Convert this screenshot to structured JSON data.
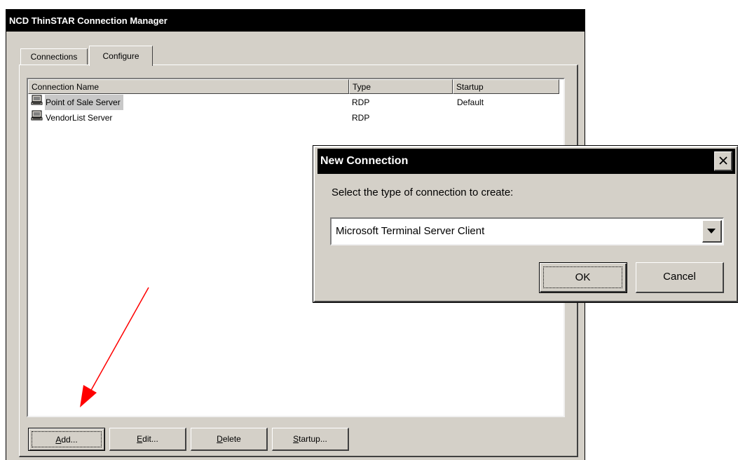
{
  "window": {
    "title": "NCD ThinSTAR Connection Manager"
  },
  "tabs": [
    {
      "label": "Connections"
    },
    {
      "label": "Configure",
      "active": true
    }
  ],
  "list": {
    "columns": [
      "Connection Name",
      "Type",
      "Startup"
    ],
    "rows": [
      {
        "name": "Point of Sale Server",
        "type": "RDP",
        "startup": "Default",
        "selected": true,
        "icon": "computer-icon"
      },
      {
        "name": "VendorList Server",
        "type": "RDP",
        "startup": "",
        "selected": false,
        "icon": "computer-icon"
      }
    ]
  },
  "buttons": {
    "add": {
      "mnemonic": "A",
      "rest": "dd..."
    },
    "edit": {
      "mnemonic": "E",
      "rest": "dit..."
    },
    "delete": {
      "mnemonic": "D",
      "rest": "elete"
    },
    "startup": {
      "mnemonic": "S",
      "rest": "tartup..."
    }
  },
  "dialog": {
    "title": "New Connection",
    "close_icon": "close-icon",
    "prompt": "Select the type of connection to create:",
    "selected_type": "Microsoft Terminal Server Client",
    "ok_label": "OK",
    "cancel_label": "Cancel"
  },
  "colors": {
    "title_bar": "#000000",
    "face": "#d4d0c8",
    "annotation_arrow": "#ff0000"
  }
}
